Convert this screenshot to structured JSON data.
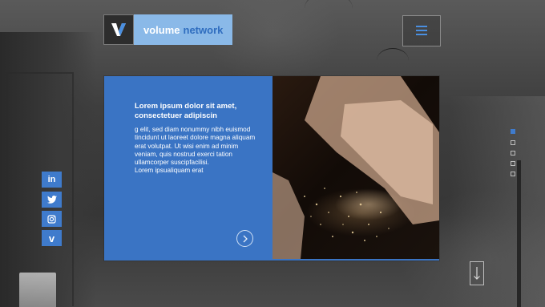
{
  "brand": {
    "name_part1": "volume",
    "name_part2": "network",
    "logo_letter": "V",
    "colors": {
      "accent": "#3a74c4",
      "logo_bg": "#8ab9e8",
      "brand_blue": "#2f6dbf"
    }
  },
  "header": {
    "menu_icon": "hamburger-icon"
  },
  "social": [
    {
      "name": "linkedin-icon",
      "glyph": "in"
    },
    {
      "name": "twitter-icon",
      "glyph": "twitter"
    },
    {
      "name": "instagram-icon",
      "glyph": "instagram"
    },
    {
      "name": "vimeo-icon",
      "glyph": "v"
    }
  ],
  "card": {
    "title": "Lorem ipsum dolor sit amet, consectetuer adipiscin",
    "body": "g elit, sed diam nonummy nibh euismod tincidunt ut laoreet dolore magna aliquam erat volutpat. Ut wisi enim ad minim veniam, quis nostrud exerci tation ullamcorper suscipfacilisi.\nLorem ipsualiquam erat",
    "next_icon": "chevron-right-circle-icon"
  },
  "pager": {
    "count": 5,
    "active_index": 0
  },
  "scroll": {
    "icon": "arrow-down-icon"
  }
}
